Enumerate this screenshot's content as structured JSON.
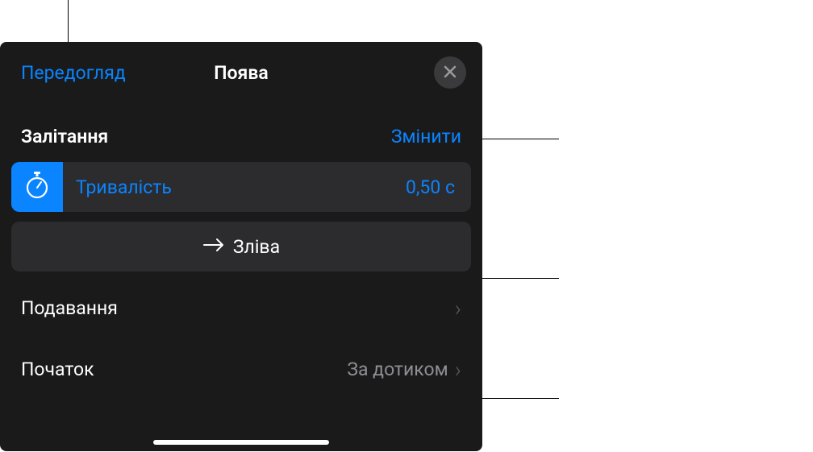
{
  "header": {
    "preview": "Передогляд",
    "title": "Поява"
  },
  "section": {
    "name": "Залітання",
    "change": "Змінити"
  },
  "duration": {
    "label": "Тривалість",
    "value": "0,50 с"
  },
  "direction": {
    "label": "Зліва"
  },
  "rows": {
    "delivery": {
      "label": "Подавання"
    },
    "start": {
      "label": "Початок",
      "value": "За дотиком"
    }
  }
}
